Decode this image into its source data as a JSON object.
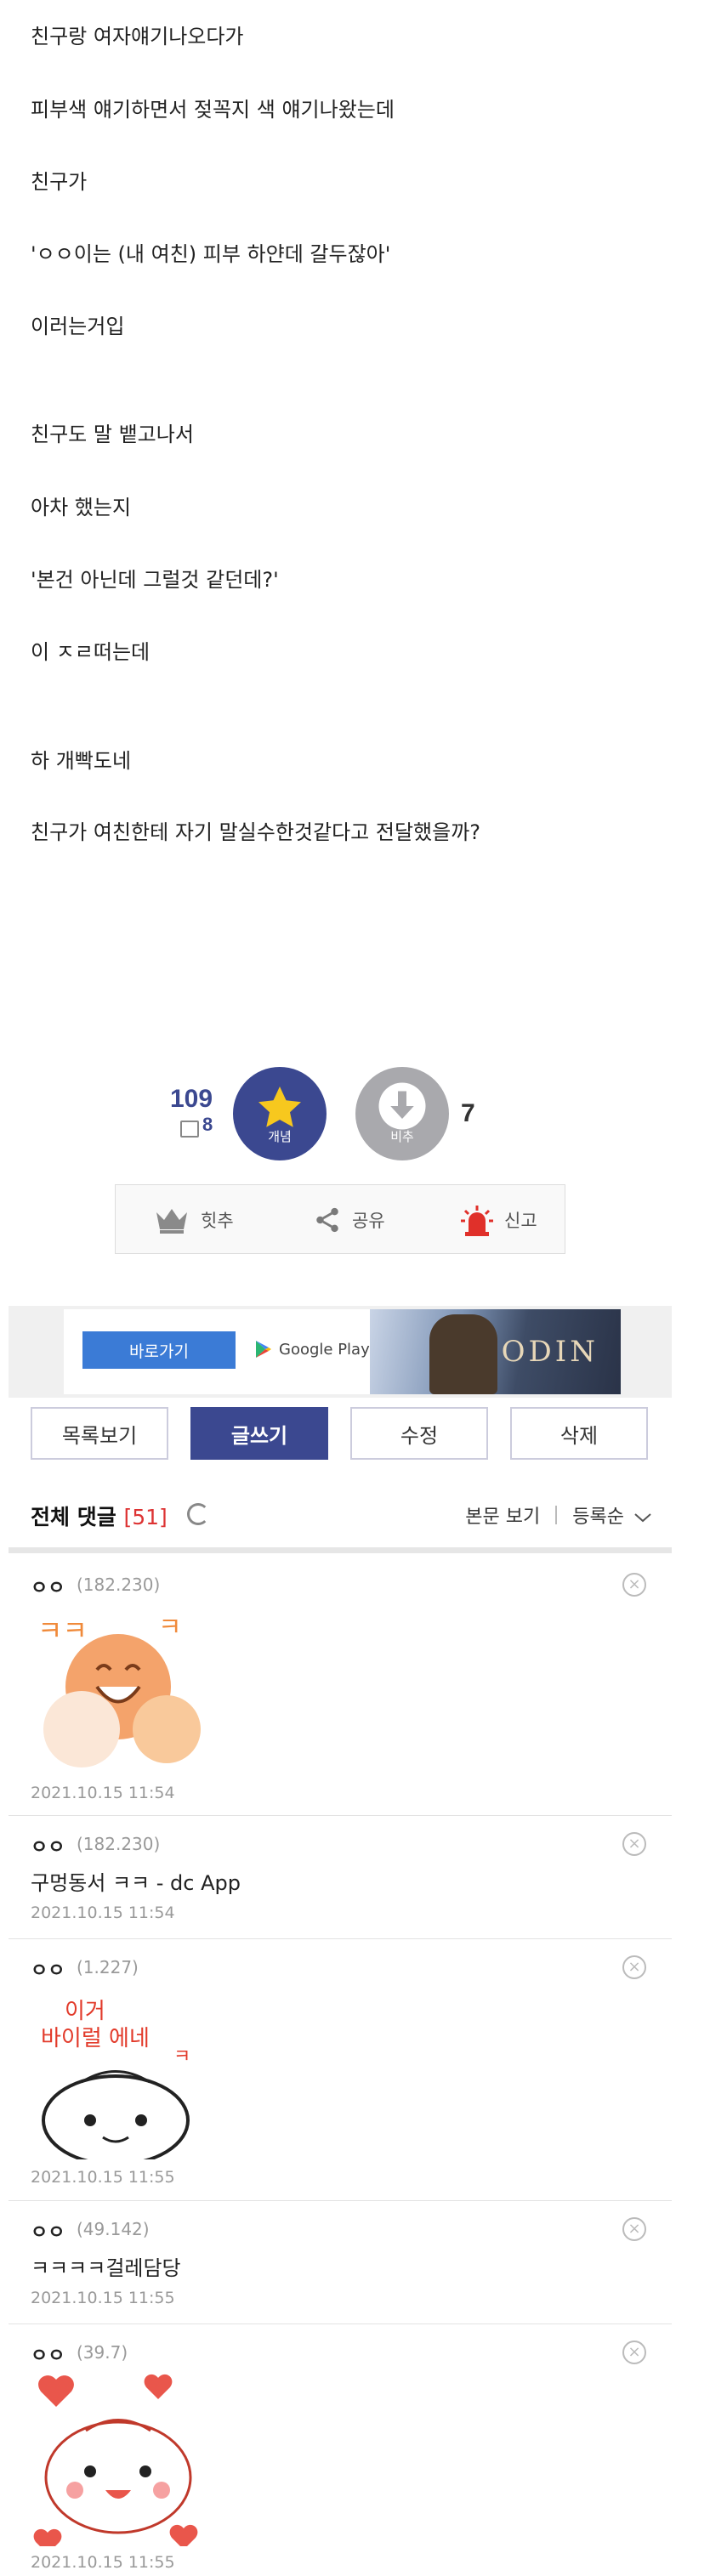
{
  "post": {
    "lines": [
      "친구랑 여자얘기나오다가",
      "피부색 얘기하면서 젖꼭지 색 얘기나왔는데",
      "친구가",
      "'ㅇㅇ이는 (내 여친) 피부 하얀데 갈두잖아'",
      "이러는거입",
      "친구도 말 뱉고나서",
      "아차 했는지",
      "'본건 아닌데 그럴것 같던데?'",
      "이 ㅈㄹ떠는데",
      "하 개빡도네",
      "친구가 여친한테 자기 말실수한것같다고 전달했을까?"
    ]
  },
  "vote": {
    "up_count": "109",
    "fixed_count": "8",
    "up_label": "개념",
    "down_label": "비추",
    "down_count": "7"
  },
  "actions": {
    "recommend": "힛추",
    "share": "공유",
    "report": "신고"
  },
  "ad": {
    "button": "바로가기",
    "store": "Google Play",
    "logo": "ODIN"
  },
  "buttons": {
    "list": "목록보기",
    "write": "글쓰기",
    "edit": "수정",
    "delete": "삭제"
  },
  "comments_header": {
    "title": "전체 댓글",
    "count": "[51]",
    "view_post": "본문 보기",
    "sort": "등록순"
  },
  "comments": [
    {
      "nick": "ㅇㅇ",
      "ip": "(182.230)",
      "text": "",
      "sticker": "laughing-dumpling-sticker",
      "date": "2021.10.15 11:54"
    },
    {
      "nick": "ㅇㅇ",
      "ip": "(182.230)",
      "text": "구멍동서 ㅋㅋ - dc App",
      "sticker": "",
      "date": "2021.10.15 11:54"
    },
    {
      "nick": "ㅇㅇ",
      "ip": "(1.227)",
      "text": "",
      "sticker": "dumpling-sticker",
      "sticker_caption": [
        "이거",
        "바이럴 에네",
        "ㅋ"
      ],
      "date": "2021.10.15 11:55"
    },
    {
      "nick": "ㅇㅇ",
      "ip": "(49.142)",
      "text": "ㅋㅋㅋㅋ걸레담당",
      "sticker": "",
      "date": "2021.10.15 11:55"
    },
    {
      "nick": "ㅇㅇ",
      "ip": "(39.7)",
      "text": "",
      "sticker": "hearts-dumpling-sticker",
      "date": "2021.10.15 11:55"
    }
  ],
  "colors": {
    "accent": "#3b4890",
    "count": "#dd3333",
    "muted": "#999999"
  }
}
